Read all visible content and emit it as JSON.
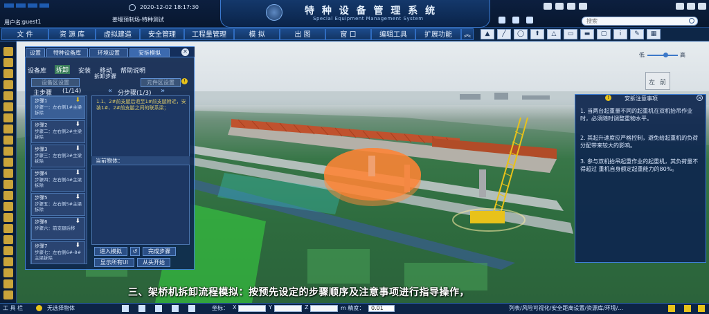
{
  "header": {
    "datetime": "2020-12-02 18:17:30",
    "project": "姜堰预制场-特种测试",
    "title": "特 种 设 备 管 理 系 统",
    "subtitle": "Special Equipment Management System",
    "user_label": "用户名：",
    "user_name": "guest1",
    "search_placeholder": "搜索"
  },
  "menu": [
    "文 件",
    "资 源 库",
    "虚拟建造",
    "安全管理",
    "工程量管理",
    "模 拟",
    "出 图",
    "窗 口",
    "编辑工具",
    "扩展功能"
  ],
  "view": {
    "quality_low": "低",
    "quality_high": "高",
    "cube_left": "左",
    "cube_front": "前"
  },
  "left_panel": {
    "tabs": [
      "设置",
      "特种设备库",
      "环境设置",
      "安拆模拟"
    ],
    "subtabs": [
      "设备库",
      "拆卸",
      "安装",
      "移动",
      "帮助说明"
    ],
    "group_label": "拆卸步骤",
    "device_area": "设备区设置",
    "component_area": "元件区设置",
    "main_steps_label": "主步骤",
    "main_steps_count": "(1/14)",
    "sub_steps_label": "分步骤(1/3)",
    "sub_step_text": "1.1、2#前支腿后退至1#前支腿附近，安装1#、2#前支腿之间的联系梁；",
    "current_object": "当前物体：",
    "steps": [
      {
        "head": "步骤1",
        "desc": ""
      },
      {
        "head": "步骤2",
        "desc": "步骤二：左右侧2#主梁拆除"
      },
      {
        "head": "步骤3",
        "desc": "步骤三：左右侧3#主梁拆除"
      },
      {
        "head": "步骤4",
        "desc": "步骤四：左右侧4#主梁拆除"
      },
      {
        "head": "步骤5",
        "desc": "步骤五：左右侧5#主梁拆除"
      },
      {
        "head": "步骤6",
        "desc": "步骤六：前支腿后移"
      },
      {
        "head": "步骤7",
        "desc": "步骤七：左右侧6#-8#主梁拆除"
      }
    ],
    "step1_desc": "步骤一：左右侧1#主梁拆除",
    "buttons": {
      "enter": "进入模拟",
      "complete": "完成步骤",
      "show_all": "显示所有UI",
      "restart": "从头开始"
    }
  },
  "notice": {
    "title": "安拆注意事项",
    "items": [
      "1. 当两台起重量不同的起重机在双机抬吊作业时，必须随时调整重物水平。",
      "2. 其起升速度应严格控制，避免给起重机的负荷分配带来较大的影响。",
      "3. 参与双机抬吊起重作业的起重机，其负荷量不得超过 重机自身额定起重能力的80%。"
    ]
  },
  "caption": "三、架桥机拆卸流程模拟：按预先设定的步骤顺序及注意事项进行指导操作，",
  "statusbar": {
    "tools_label": "工 具 栏",
    "selection": "无选择物体",
    "coord_label": "坐标：",
    "x_label": "X",
    "y_label": "Y",
    "z_label": "Z",
    "precision_label": "m 精度：",
    "precision_value": "0.01",
    "right_text": "列表/风险可视化/安全距离设置/资源库/环境/..."
  },
  "colors": {
    "accent": "#3f7fd6",
    "panel": "#0e264e",
    "crane": "#e8c21a",
    "bridge": "#c0522e",
    "zone": "#ff7a2e"
  }
}
